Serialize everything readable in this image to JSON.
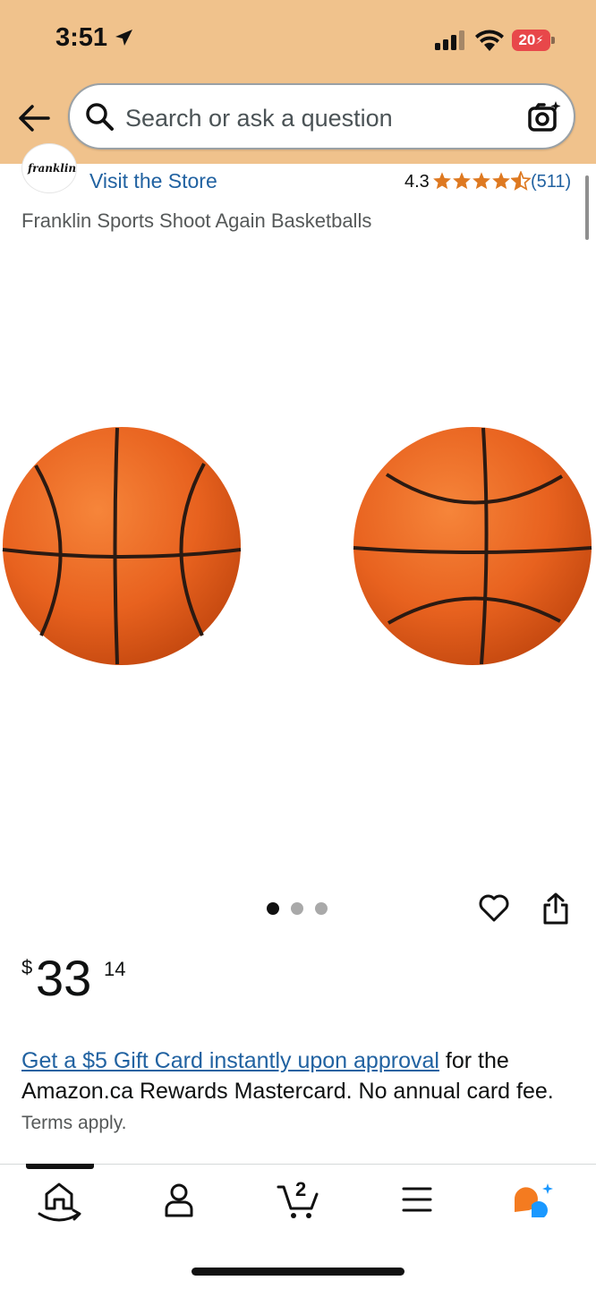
{
  "status_bar": {
    "time": "3:51",
    "battery": "20"
  },
  "search": {
    "placeholder": "Search or ask a question"
  },
  "store": {
    "logo_text": "franklin",
    "visit_label": "Visit the Store",
    "rating": "4.3",
    "rating_stars": 4.3,
    "rating_count": "(511)"
  },
  "product": {
    "title": "Franklin Sports Shoot Again Basketballs",
    "image_count": 3,
    "active_image": 0
  },
  "price": {
    "symbol": "$",
    "whole": "33",
    "fraction": "14"
  },
  "promo": {
    "link_text": "Get a $5 Gift Card instantly upon approval",
    "text": " for the Amazon.ca Rewards Mastercard. No annual card fee.",
    "terms": "Terms apply."
  },
  "cart": {
    "count": "2"
  },
  "colors": {
    "header_bg": "#f0c28c",
    "link": "#2162a1",
    "star": "#de7921",
    "ball": "#e8621f",
    "rufus_orange": "#f47b20",
    "rufus_blue": "#1a98ff"
  },
  "icons": {
    "back": "back-arrow-icon",
    "search": "search-icon",
    "camera": "camera-icon",
    "heart": "heart-icon",
    "share": "share-icon",
    "home": "home-icon",
    "account": "account-icon",
    "cart": "cart-icon",
    "menu": "menu-icon",
    "assistant": "rufus-icon"
  }
}
